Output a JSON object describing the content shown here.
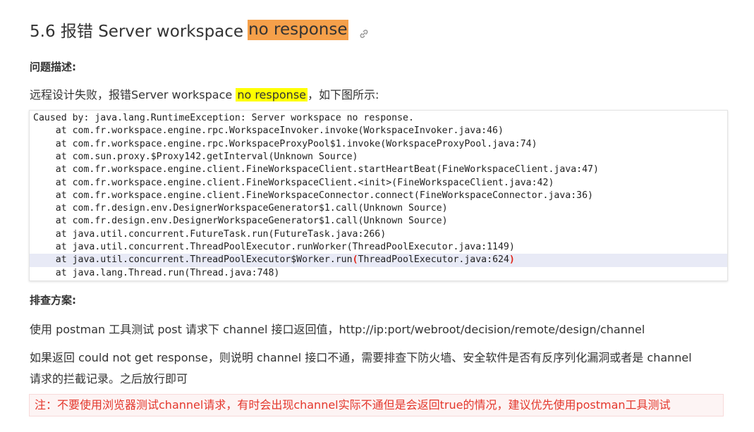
{
  "heading": {
    "prefix": "5.6 报错 Server workspace",
    "highlight": "no response",
    "highlight_color": "#f5a04a"
  },
  "problem": {
    "title": "问题描述:",
    "text_before": "远程设计失败，报错Server workspace ",
    "text_highlight": "no response",
    "text_after": "，如下图所示:",
    "highlight_color": "#ffff00"
  },
  "stacktrace": {
    "lines": [
      "Caused by: java.lang.RuntimeException: Server workspace no response.",
      "    at com.fr.workspace.engine.rpc.WorkspaceInvoker.invoke(WorkspaceInvoker.java:46)",
      "    at com.fr.workspace.engine.rpc.WorkspaceProxyPool$1.invoke(WorkspaceProxyPool.java:74)",
      "    at com.sun.proxy.$Proxy142.getInterval(Unknown Source)",
      "    at com.fr.workspace.engine.client.FineWorkspaceClient.startHeartBeat(FineWorkspaceClient.java:47)",
      "    at com.fr.workspace.engine.client.FineWorkspaceClient.<init>(FineWorkspaceClient.java:42)",
      "    at com.fr.workspace.engine.client.FineWorkspaceConnector.connect(FineWorkspaceConnector.java:36)",
      "    at com.fr.design.env.DesignerWorkspaceGenerator$1.call(Unknown Source)",
      "    at com.fr.design.env.DesignerWorkspaceGenerator$1.call(Unknown Source)",
      "    at java.util.concurrent.FutureTask.run(FutureTask.java:266)",
      "    at java.util.concurrent.ThreadPoolExecutor.runWorker(ThreadPoolExecutor.java:1149)",
      "    at java.util.concurrent.ThreadPoolExecutor$Worker.run",
      "    at java.lang.Thread.run(Thread.java:748)"
    ],
    "active_line_args": "ThreadPoolExecutor.java:624",
    "active_line_color": "#e8eaf6"
  },
  "solution": {
    "title": "排查方案:",
    "para1": "使用 postman 工具测试 post 请求下 channel 接口返回值，http://ip:port/webroot/decision/remote/design/channel",
    "para2_line1": "如果返回 could not get response，则说明 channel 接口不通，需要排查下防火墙、安全软件是否有反序列化漏洞或者是 channel",
    "para2_line2": "请求的拦截记录。之后放行即可"
  },
  "note": {
    "text": "注：不要使用浏览器测试channel请求，有时会出现channel实际不通但是会返回true的情况，建议优先使用postman工具测试",
    "color": "#e4372c"
  },
  "icons": {
    "anchor": "link-icon"
  }
}
